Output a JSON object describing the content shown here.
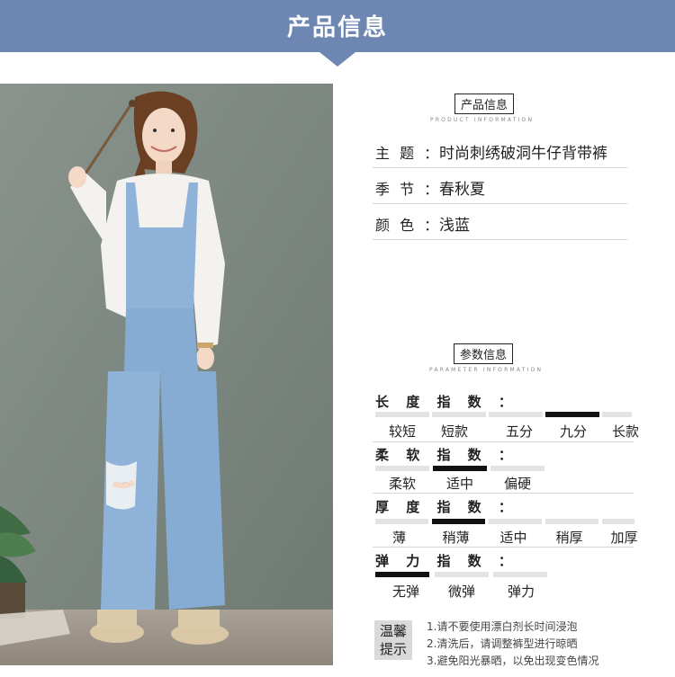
{
  "header": {
    "title": "产品信息"
  },
  "product_section": {
    "tag": "产品信息",
    "subtitle": "PRODUCT INFORMATION",
    "rows": [
      {
        "label": "主 题 ：",
        "value": "时尚刺绣破洞牛仔背带裤"
      },
      {
        "label": "季 节 ：",
        "value": "春秋夏"
      },
      {
        "label": "颜 色 ：",
        "value": "浅蓝"
      }
    ]
  },
  "param_section": {
    "tag": "参数信息",
    "subtitle": "PARAMETER INFORMATION",
    "groups": [
      {
        "title": "长 度 指 数 ：",
        "options": [
          "较短",
          "短款",
          "五分",
          "九分",
          "长款"
        ],
        "selected": "九分"
      },
      {
        "title": "柔 软 指 数 ：",
        "options": [
          "柔软",
          "适中",
          "偏硬"
        ],
        "selected": "适中"
      },
      {
        "title": "厚 度 指 数 ：",
        "options": [
          "薄",
          "稍薄",
          "适中",
          "稍厚",
          "加厚"
        ],
        "selected": "稍薄"
      },
      {
        "title": "弹 力 指 数 ：",
        "options": [
          "无弹",
          "微弹",
          "弹力"
        ],
        "selected": "无弹"
      }
    ]
  },
  "tips": {
    "label_line1": "温馨",
    "label_line2": "提示",
    "lines": [
      "1.请不要使用漂白剂长时间浸泡",
      "2.清洗后，请调整裤型进行晾晒",
      "3.避免阳光暴晒，以免出现变色情况"
    ]
  },
  "colors": {
    "header": "#6d86b2",
    "wall": "#7f8a83",
    "denim": "#8fb3d8"
  }
}
